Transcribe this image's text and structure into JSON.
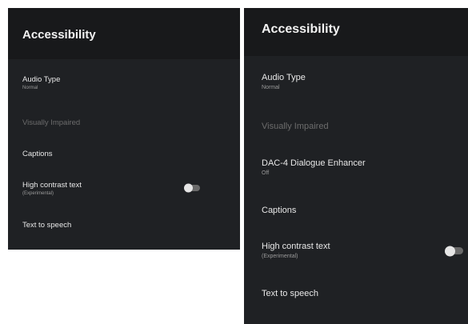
{
  "left_panel": {
    "title": "Accessibility",
    "items": [
      {
        "title": "Audio Type",
        "subtitle": "Normal"
      },
      {
        "title": "Visually Impaired"
      },
      {
        "title": "Captions"
      },
      {
        "title": "High contrast text",
        "subtitle": "(Experimental)",
        "toggle": "off"
      },
      {
        "title": "Text to speech"
      }
    ]
  },
  "right_panel": {
    "title": "Accessibility",
    "items": [
      {
        "title": "Audio Type",
        "subtitle": "Normal"
      },
      {
        "title": "Visually Impaired"
      },
      {
        "title": "DAC-4 Dialogue Enhancer",
        "subtitle": "Off"
      },
      {
        "title": "Captions"
      },
      {
        "title": "High contrast text",
        "subtitle": "(Experimental)",
        "toggle": "off"
      },
      {
        "title": "Text to speech"
      }
    ]
  }
}
